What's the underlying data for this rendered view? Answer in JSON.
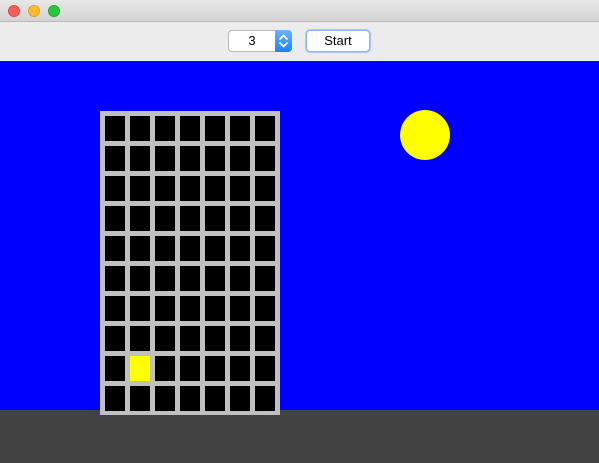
{
  "toolbar": {
    "floor_count_value": "3",
    "start_label": "Start"
  },
  "scene": {
    "sky_color": "#0000fe",
    "ground_color": "#424242",
    "sun_color": "#fffe00",
    "building_color": "#c0c0c0",
    "window_color": "#000000",
    "lit_window_color": "#fffe00",
    "building": {
      "rows": 10,
      "columns": 7,
      "lit_windows": [
        {
          "row": 8,
          "column": 1
        }
      ]
    }
  }
}
